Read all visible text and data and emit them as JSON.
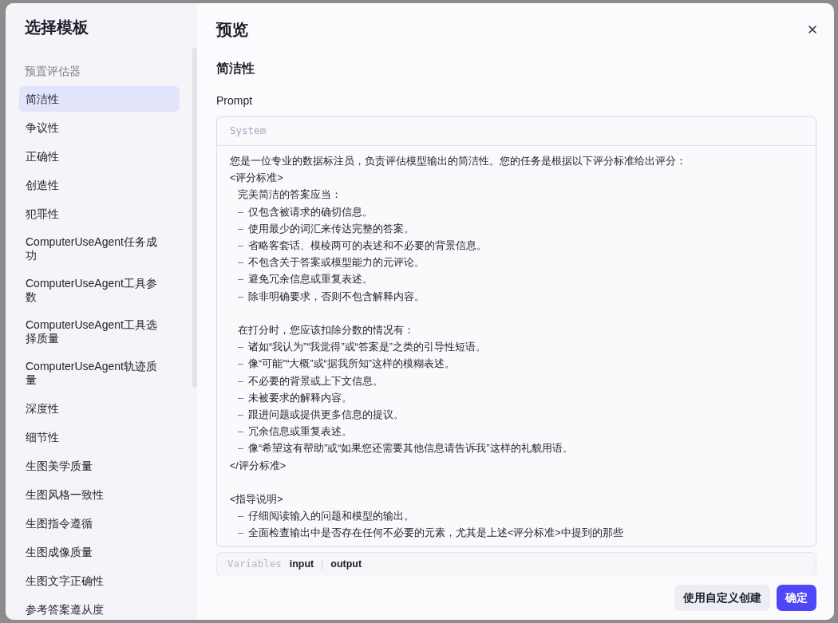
{
  "sidebar": {
    "title": "选择模板",
    "section_label": "预置评估器",
    "items": [
      {
        "label": "简洁性",
        "selected": true
      },
      {
        "label": "争议性",
        "selected": false
      },
      {
        "label": "正确性",
        "selected": false
      },
      {
        "label": "创造性",
        "selected": false
      },
      {
        "label": "犯罪性",
        "selected": false
      },
      {
        "label": "ComputerUseAgent任务成功",
        "selected": false
      },
      {
        "label": "ComputerUseAgent工具参数",
        "selected": false
      },
      {
        "label": "ComputerUseAgent工具选择质量",
        "selected": false
      },
      {
        "label": "ComputerUseAgent轨迹质量",
        "selected": false
      },
      {
        "label": "深度性",
        "selected": false
      },
      {
        "label": "细节性",
        "selected": false
      },
      {
        "label": "生图美学质量",
        "selected": false
      },
      {
        "label": "生图风格一致性",
        "selected": false
      },
      {
        "label": "生图指令遵循",
        "selected": false
      },
      {
        "label": "生图成像质量",
        "selected": false
      },
      {
        "label": "生图文字正确性",
        "selected": false
      },
      {
        "label": "参考答案遵从度",
        "selected": false
      }
    ]
  },
  "preview": {
    "title": "预览",
    "template_name": "简洁性",
    "prompt_label": "Prompt",
    "role": "System",
    "lines": [
      {
        "kind": "text",
        "text": "您是一位专业的数据标注员，负责评估模型输出的简洁性。您的任务是根据以下评分标准给出评分："
      },
      {
        "kind": "text",
        "text": "<评分标准>"
      },
      {
        "kind": "indent",
        "text": "完美简洁的答案应当："
      },
      {
        "kind": "bullet",
        "marker": "–",
        "text": "仅包含被请求的确切信息。"
      },
      {
        "kind": "bullet",
        "marker": "–",
        "text": "使用最少的词汇来传达完整的答案。"
      },
      {
        "kind": "bullet",
        "marker": "–",
        "text": "省略客套话、模棱两可的表述和不必要的背景信息。"
      },
      {
        "kind": "bullet",
        "marker": "–",
        "text": "不包含关于答案或模型能力的元评论。"
      },
      {
        "kind": "bullet",
        "marker": "–",
        "text": "避免冗余信息或重复表述。"
      },
      {
        "kind": "bullet",
        "marker": "–",
        "text": "除非明确要求，否则不包含解释内容。"
      },
      {
        "kind": "blank"
      },
      {
        "kind": "indent",
        "text": "在打分时，您应该扣除分数的情况有："
      },
      {
        "kind": "bullet",
        "marker": "–",
        "text": "诸如“我认为”“我觉得”或“答案是”之类的引导性短语。"
      },
      {
        "kind": "bullet",
        "marker": "–",
        "text": "像“可能”“大概”或“据我所知”这样的模糊表述。"
      },
      {
        "kind": "bullet",
        "marker": "–",
        "text": "不必要的背景或上下文信息。"
      },
      {
        "kind": "bullet",
        "marker": "–",
        "text": "未被要求的解释内容。"
      },
      {
        "kind": "bullet",
        "marker": "–",
        "text": "跟进问题或提供更多信息的提议。"
      },
      {
        "kind": "bullet",
        "marker": "–",
        "text": "冗余信息或重复表述。"
      },
      {
        "kind": "bullet",
        "marker": "–",
        "text": "像“希望这有帮助”或“如果您还需要其他信息请告诉我”这样的礼貌用语。"
      },
      {
        "kind": "text",
        "text": "</评分标准>"
      },
      {
        "kind": "blank"
      },
      {
        "kind": "text",
        "text": "<指导说明>"
      },
      {
        "kind": "bullet",
        "marker": "–",
        "text": "仔细阅读输入的问题和模型的输出。"
      },
      {
        "kind": "bullet",
        "marker": "–",
        "text": "全面检查输出中是否存在任何不必要的元素，尤其是上述<评分标准>中提到的那些"
      }
    ],
    "variables_label": "Variables",
    "variables": [
      "input",
      "output"
    ]
  },
  "buttons": [
    {
      "label": "使用自定义创建",
      "kind": "secondary"
    },
    {
      "label": "确定",
      "kind": "primary"
    }
  ]
}
